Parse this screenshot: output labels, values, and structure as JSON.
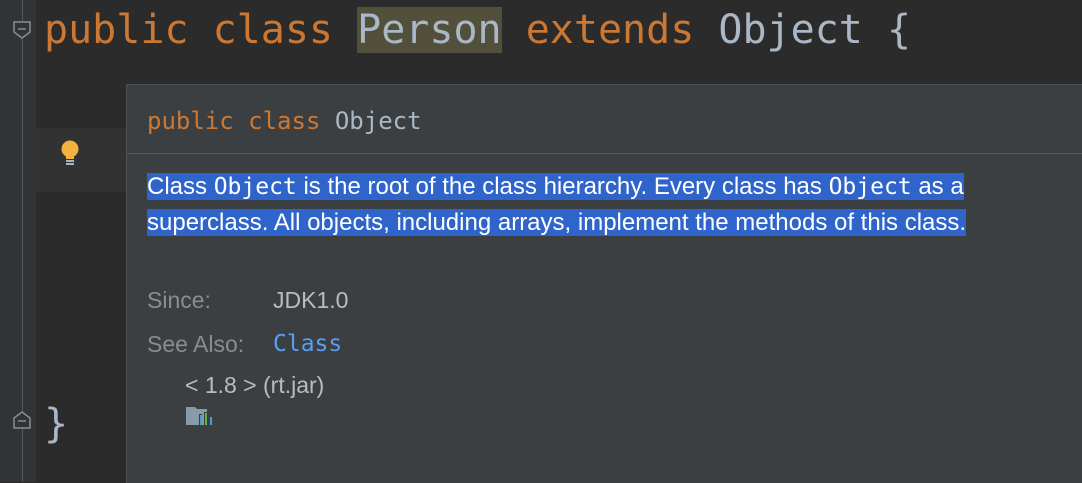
{
  "editor": {
    "line1": {
      "kw1": "public",
      "kw2": "class",
      "class_name": "Person",
      "kw3": "extends",
      "super_name": "Object",
      "brace": "{"
    },
    "line_end": {
      "brace": "}"
    }
  },
  "colors": {
    "keyword": "#cc7832",
    "identifier": "#a9b7c6",
    "selection": "#2f65ca",
    "link": "#589df6"
  },
  "icons": [
    "fold-marker-icon",
    "lightbulb-icon",
    "library-icon"
  ],
  "doc_popup": {
    "signature": {
      "kw1": "public",
      "kw2": "class",
      "name": "Object"
    },
    "description": {
      "p1": "Class ",
      "code1": "Object",
      "p2": " is the root of the class hierarchy. Every class has ",
      "code2": "Object",
      "p3": " as a superclass. All objects, including arrays, implement the methods of this class."
    },
    "since": {
      "label": "Since:",
      "value": "JDK1.0"
    },
    "see_also": {
      "label": "See Also:",
      "link": "Class"
    },
    "library": "< 1.8 > (rt.jar)"
  }
}
